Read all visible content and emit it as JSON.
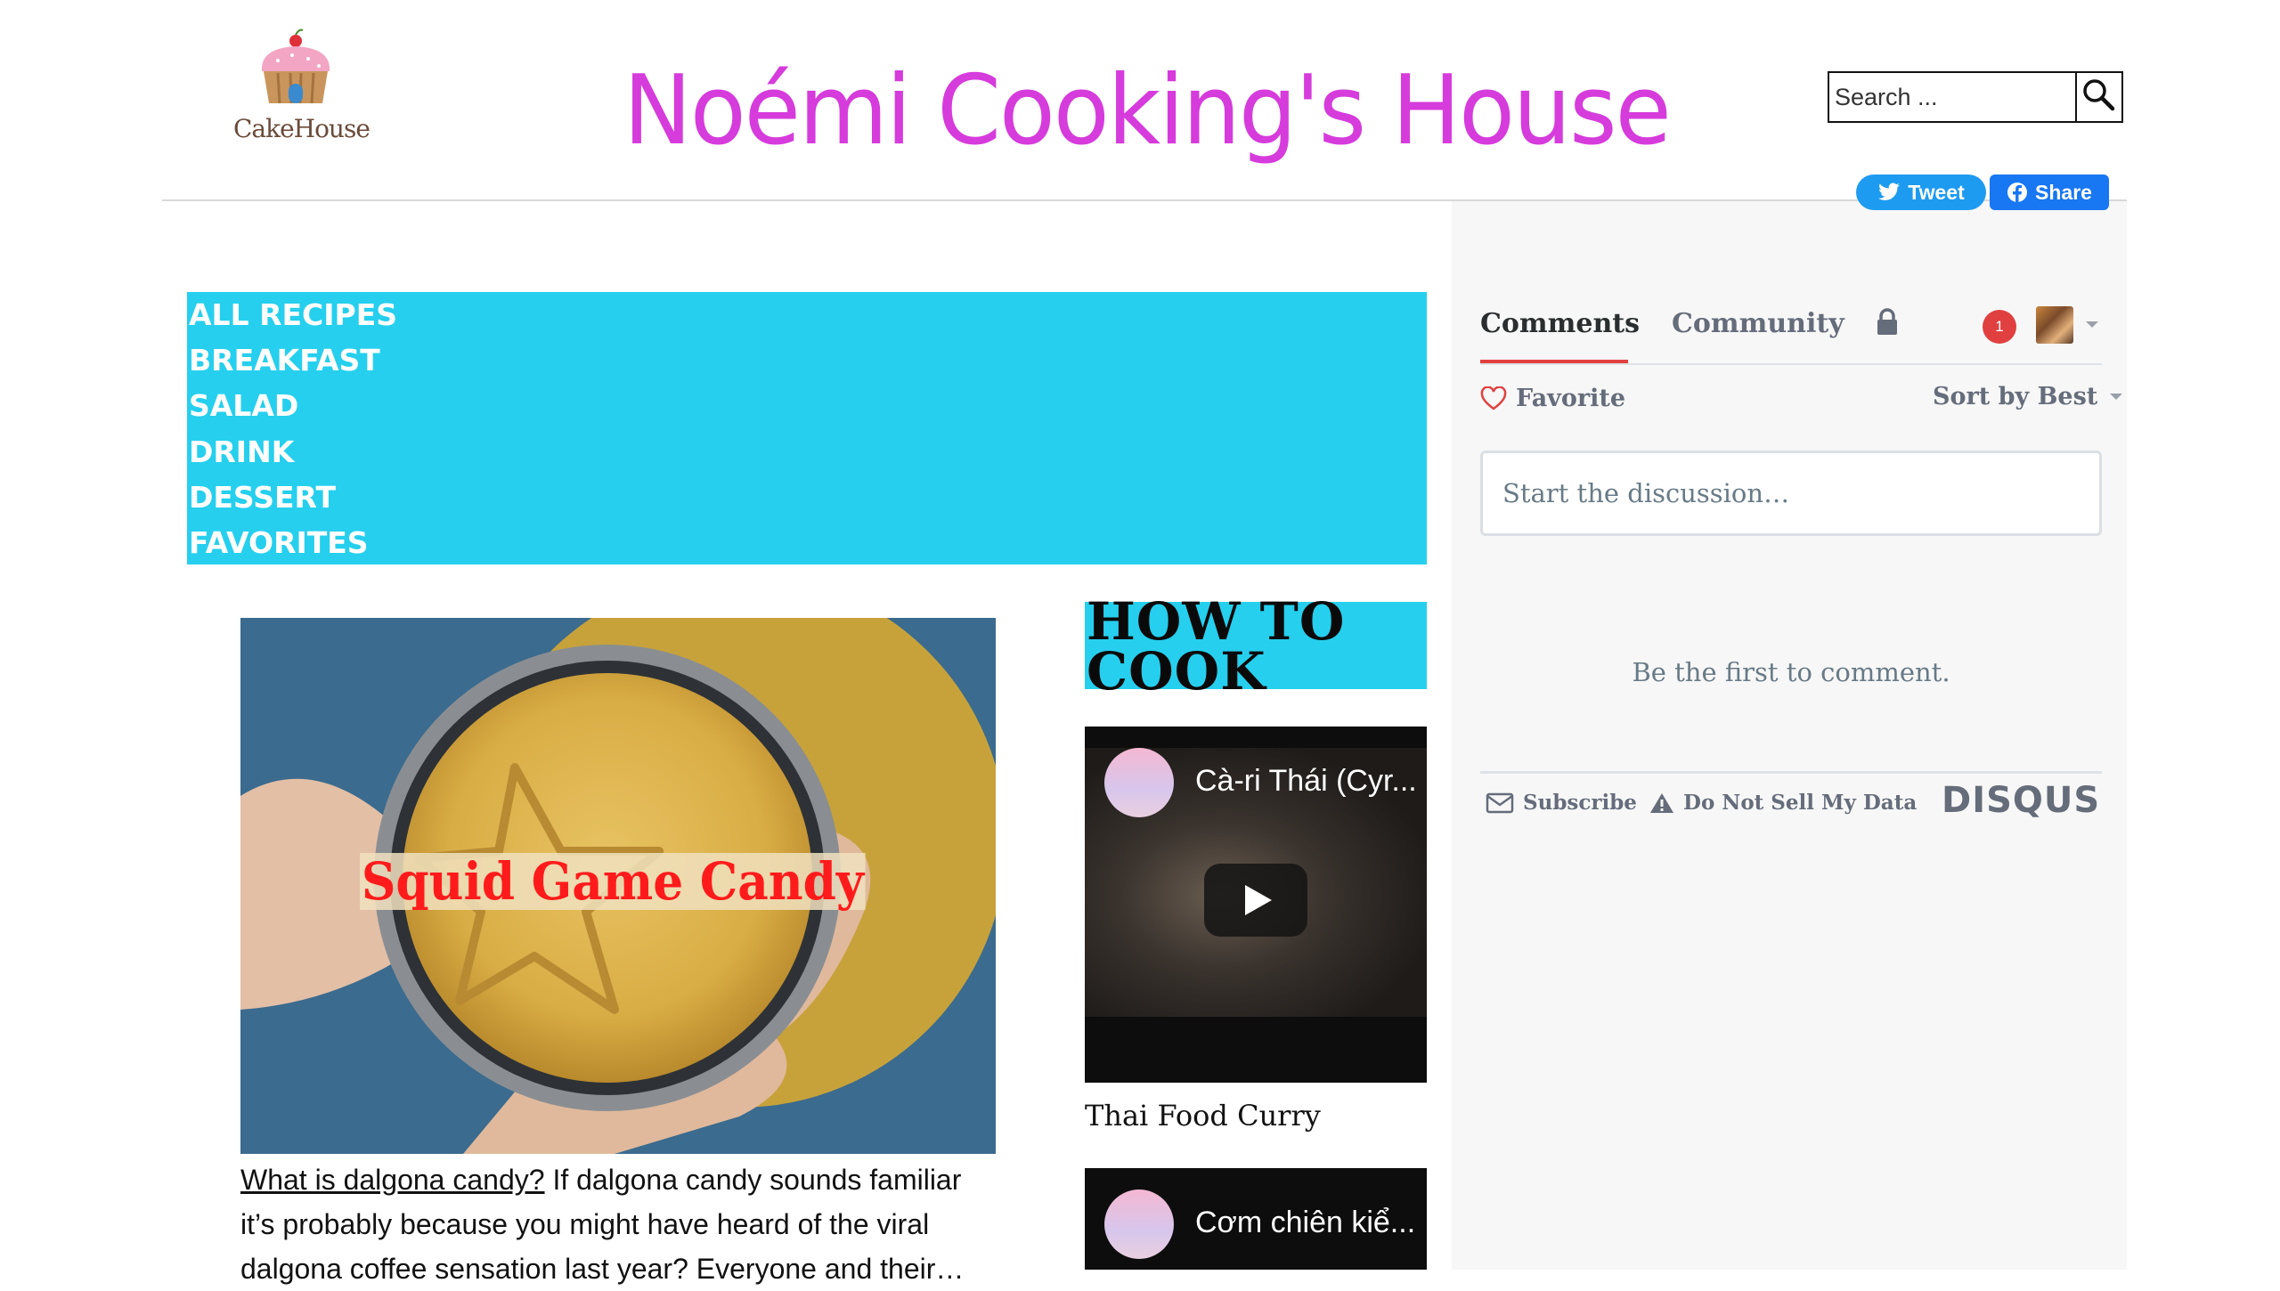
{
  "site": {
    "title": "Noémi Cooking's House",
    "logo_text": "CakeHouse"
  },
  "search": {
    "placeholder": "Search ..."
  },
  "social": {
    "tweet_label": "Tweet",
    "share_label": "Share"
  },
  "nav": {
    "items": [
      {
        "label": "ALL RECIPES"
      },
      {
        "label": "BREAKFAST"
      },
      {
        "label": "SALAD"
      },
      {
        "label": "DRINK"
      },
      {
        "label": "DESSERT"
      },
      {
        "label": "FAVORITES"
      }
    ]
  },
  "article": {
    "image_caption": "Squid Game Candy",
    "link_text": "What is dalgona candy?",
    "excerpt": " If dalgona candy sounds familiar it’s probably because you might have heard of the viral dalgona coffee sensation last year? Everyone and their…"
  },
  "how_to_cook": {
    "title_line1": "HOW TO",
    "title_line2": "COOK",
    "videos": [
      {
        "title": "Cà-ri Thái (Cyr...",
        "caption": "Thai Food Curry"
      },
      {
        "title": "Cơm chiên kiể..."
      }
    ]
  },
  "comments": {
    "tab_comments": "Comments",
    "tab_community": "Community",
    "notification_count": "1",
    "favorite_label": "Favorite",
    "sort_label": "Sort by Best",
    "input_placeholder": "Start the discussion…",
    "empty_text": "Be the first to comment.",
    "subscribe_label": "Subscribe",
    "do_not_sell_label": "Do Not Sell My Data",
    "brand": "DISQUS"
  },
  "colors": {
    "title": "#d63bdc",
    "nav_bg": "#26cfee",
    "disqus_red": "#e0403f",
    "twitter": "#1d9bf0",
    "facebook": "#1877f2"
  },
  "icons": [
    "cupcake-logo",
    "search-icon",
    "twitter-bird-icon",
    "facebook-icon",
    "lock-icon",
    "chevron-down-icon",
    "heart-icon",
    "envelope-icon",
    "warning-icon",
    "play-icon"
  ]
}
